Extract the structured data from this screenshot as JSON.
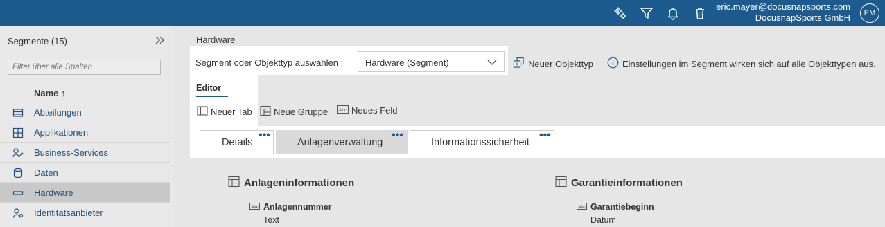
{
  "topbar": {
    "icons": [
      "settings-icon",
      "filter-icon",
      "bell-icon",
      "trash-icon"
    ],
    "user_email": "eric.mayer@docusnapsports.com",
    "user_company": "DocusnapSports GmbH",
    "avatar_initials": "EM"
  },
  "sidebar": {
    "title": "Segmente (15)",
    "filter_placeholder": "Filter über alle Spalten",
    "column_header": "Name ↑",
    "items": [
      {
        "label": "Abteilungen",
        "icon": "department-icon"
      },
      {
        "label": "Applikationen",
        "icon": "applications-icon"
      },
      {
        "label": "Business-Services",
        "icon": "business-services-icon"
      },
      {
        "label": "Daten",
        "icon": "database-icon"
      },
      {
        "label": "Hardware",
        "icon": "hardware-icon",
        "selected": true
      },
      {
        "label": "Identitätsanbieter",
        "icon": "identity-icon"
      }
    ]
  },
  "main": {
    "title": "Hardware",
    "segment_label": "Segment oder Objekttyp auswählen :",
    "segment_value": "Hardware (Segment)",
    "new_objecttype": "Neuer Objekttyp",
    "info_text": "Einstellungen im Segment wirken sich auf alle Objekttypen aus.",
    "editor_tab": "Editor",
    "toolbar": {
      "new_tab": "Neuer Tab",
      "new_group": "Neue Gruppe",
      "new_field": "Neues Feld"
    },
    "tabs": [
      {
        "label": "Details"
      },
      {
        "label": "Anlagenverwaltung",
        "active": true
      },
      {
        "label": "Informationssicherheit"
      }
    ],
    "tab_menu_glyph": "•••",
    "groups": [
      {
        "title": "Anlageninformationen",
        "field_name": "Anlagennummer",
        "field_type": "Text"
      },
      {
        "title": "Garantieinformationen",
        "field_name": "Garantiebeginn",
        "field_type": "Datum"
      }
    ]
  },
  "colors": {
    "topbar": "#1d5a8e",
    "accent": "#1d5a8e",
    "link": "#1d4f7c",
    "selected_row": "#c8c8c8"
  }
}
